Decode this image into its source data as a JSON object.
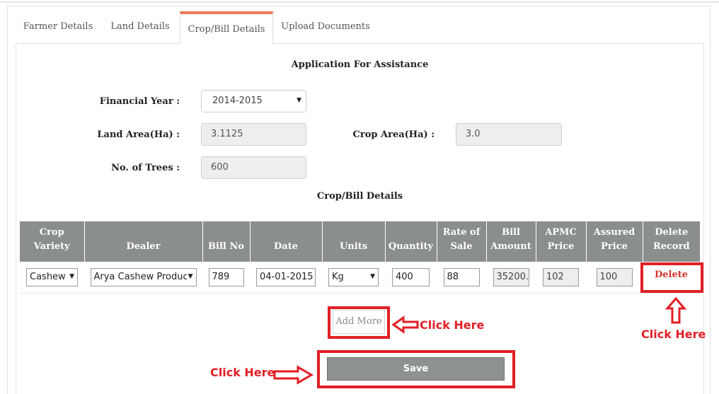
{
  "tabs": [
    {
      "label": "Farmer Details",
      "active": false
    },
    {
      "label": "Land Details",
      "active": false
    },
    {
      "label": "Crop/Bill Details",
      "active": true
    },
    {
      "label": "Upload Documents",
      "active": false
    }
  ],
  "form": {
    "title": "Application For Assistance",
    "financial_year_label": "Financial Year :",
    "financial_year_value": "2014-2015",
    "land_area_label": "Land Area(Ha) :",
    "land_area_value": "3.1125",
    "crop_area_label": "Crop Area(Ha) :",
    "crop_area_value": "3.0",
    "trees_label": "No. of Trees :",
    "trees_value": "600",
    "section_title": "Crop/Bill Details"
  },
  "table": {
    "headers": [
      [
        "Crop",
        "Variety"
      ],
      [
        "Dealer"
      ],
      [
        "Bill No"
      ],
      [
        "Date"
      ],
      [
        "Units"
      ],
      [
        "Quantity"
      ],
      [
        "Rate of",
        "Sale"
      ],
      [
        "Bill",
        "Amount"
      ],
      [
        "APMC",
        "Price"
      ],
      [
        "Assured",
        "Price"
      ],
      [
        "Delete",
        "Record"
      ]
    ],
    "row": {
      "crop_variety": "Cashew",
      "dealer": "Arya Cashew Produc",
      "bill_no": "789",
      "date": "04-01-2015",
      "units": "Kg",
      "quantity": "400",
      "rate_of_sale": "88",
      "bill_amount": "35200.0",
      "apmc_price": "102",
      "assured_price": "100",
      "delete_label": "Delete"
    }
  },
  "buttons": {
    "add_more": "Add More",
    "save": "Save"
  },
  "callouts": {
    "add_more": "Click Here",
    "delete": "Click Here",
    "save": "Click Here"
  },
  "colors": {
    "accent_tab": "#f07a5a",
    "highlight": "#e21f26",
    "table_header": "#8a8e8c",
    "delete_text": "#d4352e"
  }
}
